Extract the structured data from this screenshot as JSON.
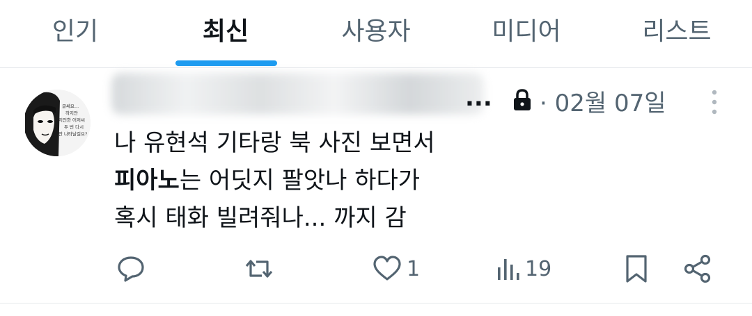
{
  "tabs": [
    {
      "label": "인기"
    },
    {
      "label": "최신"
    },
    {
      "label": "사용자"
    },
    {
      "label": "미디어"
    },
    {
      "label": "리스트"
    }
  ],
  "active_tab": "최신",
  "accent_color": "#1d9bf0",
  "tweet": {
    "display_name_visible_tail": "...",
    "protected_icon": "lock-icon",
    "separator": "·",
    "date": "02월 07일",
    "avatar_text": [
      "글쎄요...",
      "하지만",
      "지인한 어저씨",
      "두 번 다시",
      "안 나타날걸요?"
    ],
    "body_lines": [
      {
        "bold": "",
        "text": "나 유현석 기타랑 북 사진 보면서"
      },
      {
        "bold": "피아노",
        "text": "는 어딧지 팔앗나 하다가"
      },
      {
        "bold": "",
        "text": "혹시 태화 빌려줘나... 까지 감"
      }
    ],
    "actions": {
      "reply": {
        "icon": "reply-icon",
        "count": ""
      },
      "retweet": {
        "icon": "retweet-icon",
        "count": ""
      },
      "like": {
        "icon": "heart-icon",
        "count": "1"
      },
      "views": {
        "icon": "views-icon",
        "count": "19"
      },
      "bookmark": {
        "icon": "bookmark-icon",
        "count": ""
      },
      "share": {
        "icon": "share-icon",
        "count": ""
      }
    }
  }
}
